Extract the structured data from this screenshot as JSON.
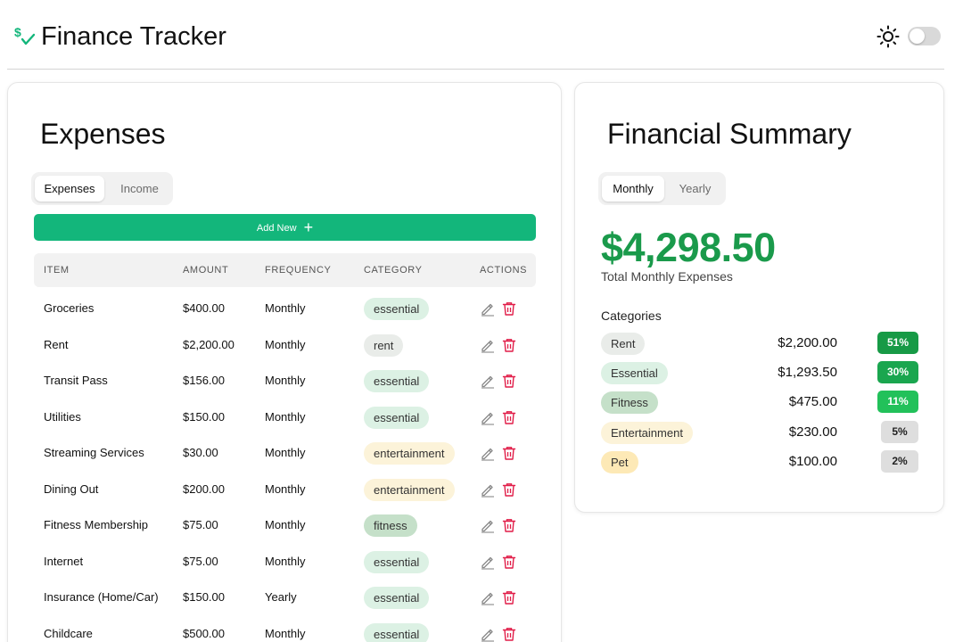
{
  "header": {
    "title": "Finance Tracker",
    "logo_icon": "dollar-check-icon",
    "theme_icon": "sun-icon",
    "theme_toggle_on": false
  },
  "colors": {
    "accent_green": "#13b67b",
    "total_green": "#1a9a4b",
    "delete_red": "#e11d48",
    "essential_badge": "#dcf1e4",
    "rent_badge": "#e9ece9",
    "entertainment_badge": "#fcf3d9",
    "fitness_badge": "#c5e0c9",
    "pet_badge": "#fde9b6"
  },
  "expenses": {
    "title": "Expenses",
    "tabs": [
      {
        "label": "Expenses",
        "active": true
      },
      {
        "label": "Income",
        "active": false
      }
    ],
    "add_button_label": "Add New",
    "columns": [
      "ITEM",
      "AMOUNT",
      "FREQUENCY",
      "CATEGORY",
      "ACTIONS"
    ],
    "rows": [
      {
        "item": "Groceries",
        "amount": "$400.00",
        "frequency": "Monthly",
        "category": "essential"
      },
      {
        "item": "Rent",
        "amount": "$2,200.00",
        "frequency": "Monthly",
        "category": "rent"
      },
      {
        "item": "Transit Pass",
        "amount": "$156.00",
        "frequency": "Monthly",
        "category": "essential"
      },
      {
        "item": "Utilities",
        "amount": "$150.00",
        "frequency": "Monthly",
        "category": "essential"
      },
      {
        "item": "Streaming Services",
        "amount": "$30.00",
        "frequency": "Monthly",
        "category": "entertainment"
      },
      {
        "item": "Dining Out",
        "amount": "$200.00",
        "frequency": "Monthly",
        "category": "entertainment"
      },
      {
        "item": "Fitness Membership",
        "amount": "$75.00",
        "frequency": "Monthly",
        "category": "fitness"
      },
      {
        "item": "Internet",
        "amount": "$75.00",
        "frequency": "Monthly",
        "category": "essential"
      },
      {
        "item": "Insurance (Home/Car)",
        "amount": "$150.00",
        "frequency": "Yearly",
        "category": "essential"
      },
      {
        "item": "Childcare",
        "amount": "$500.00",
        "frequency": "Monthly",
        "category": "essential"
      }
    ],
    "action_icons": [
      "pencil-icon",
      "trash-icon"
    ]
  },
  "summary": {
    "title": "Financial Summary",
    "tabs": [
      {
        "label": "Monthly",
        "active": true
      },
      {
        "label": "Yearly",
        "active": false
      }
    ],
    "total": "$4,298.50",
    "total_label": "Total Monthly Expenses",
    "categories_heading": "Categories",
    "categories": [
      {
        "name": "Rent",
        "amount": "$2,200.00",
        "percent": "51%",
        "pct_bg": "#179a46",
        "pct_fg": "#ffffff"
      },
      {
        "name": "Essential",
        "amount": "$1,293.50",
        "percent": "30%",
        "pct_bg": "#1aa64f",
        "pct_fg": "#ffffff"
      },
      {
        "name": "Fitness",
        "amount": "$475.00",
        "percent": "11%",
        "pct_bg": "#22c15a",
        "pct_fg": "#ffffff"
      },
      {
        "name": "Entertainment",
        "amount": "$230.00",
        "percent": "5%",
        "pct_bg": "#dedede",
        "pct_fg": "#222222"
      },
      {
        "name": "Pet",
        "amount": "$100.00",
        "percent": "2%",
        "pct_bg": "#dedede",
        "pct_fg": "#222222"
      }
    ]
  }
}
